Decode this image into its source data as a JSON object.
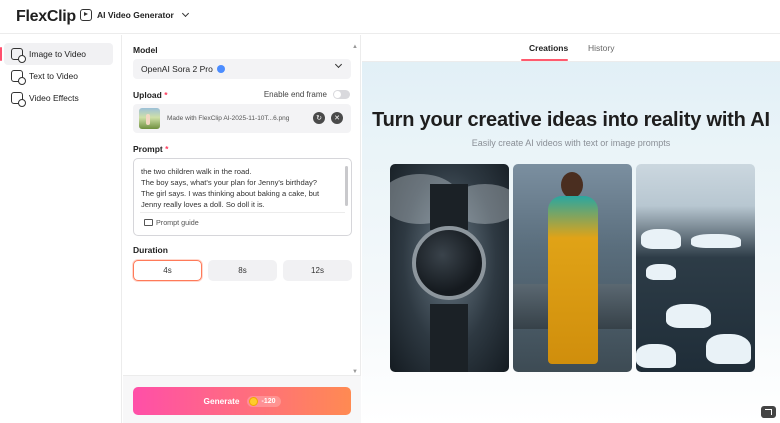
{
  "app": {
    "logo_text": "FlexClip",
    "tool_switch_label": "AI Video Generator"
  },
  "sidebar": {
    "items": [
      {
        "label": "Image to Video",
        "active": true
      },
      {
        "label": "Text to Video",
        "active": false
      },
      {
        "label": "Video Effects",
        "active": false
      }
    ]
  },
  "form": {
    "model_label": "Model",
    "model_value": "OpenAI Sora 2 Pro",
    "upload_label": "Upload",
    "required_mark": "*",
    "end_frame_label": "Enable end frame",
    "end_frame_enabled": false,
    "upload_filename": "Made with FlexClip AI-2025-11-10T...6.png",
    "prompt_label": "Prompt",
    "prompt_text": "the two children walk in the road.\nThe boy says, what's your plan for Jenny's birthday?\nThe girl says. I was thinking about baking a cake, but Jenny really loves a doll. So doll it is.",
    "prompt_guide_label": "Prompt guide",
    "duration_label": "Duration",
    "durations": [
      "4s",
      "8s",
      "12s"
    ],
    "selected_duration": "4s",
    "generate_label": "Generate",
    "generate_cost": "-120"
  },
  "right": {
    "tabs": [
      {
        "label": "Creations",
        "active": true
      },
      {
        "label": "History",
        "active": false
      }
    ],
    "hero_title": "Turn your creative ideas into reality with AI",
    "hero_subtitle": "Easily create AI videos with text or image prompts"
  },
  "colors": {
    "accent": "#ff5a6e",
    "generate_gradient_start": "#ff4fa8",
    "generate_gradient_end": "#ff8a52"
  }
}
